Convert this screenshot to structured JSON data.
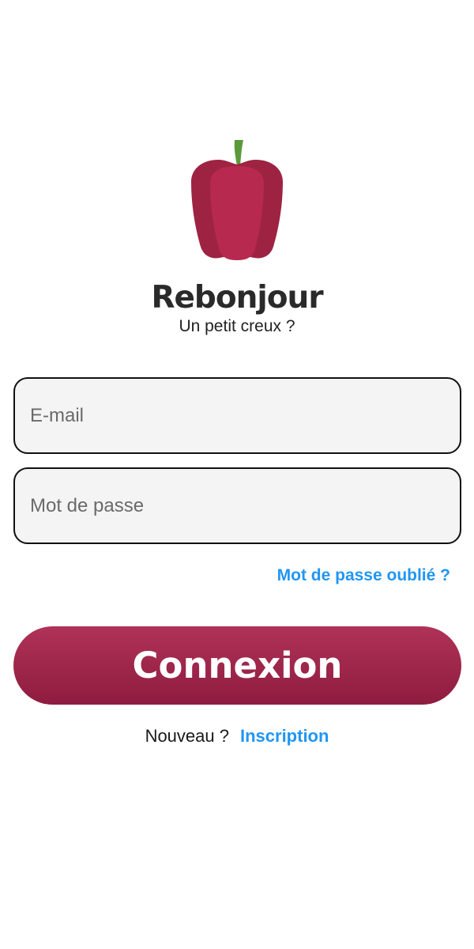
{
  "logo": {
    "icon": "bell-pepper-icon",
    "color": "#b5284c",
    "stem_color": "#5a9a3a"
  },
  "header": {
    "title": "Rebonjour",
    "subtitle": "Un petit creux ?"
  },
  "form": {
    "email": {
      "placeholder": "E-mail",
      "value": ""
    },
    "password": {
      "placeholder": "Mot de passe",
      "value": ""
    },
    "forgot_label": "Mot de passe oublié ?",
    "login_label": "Connexion"
  },
  "signup": {
    "question": "Nouveau ?",
    "link_label": "Inscription"
  },
  "colors": {
    "accent": "#2196f3",
    "brand": "#9e2448"
  }
}
